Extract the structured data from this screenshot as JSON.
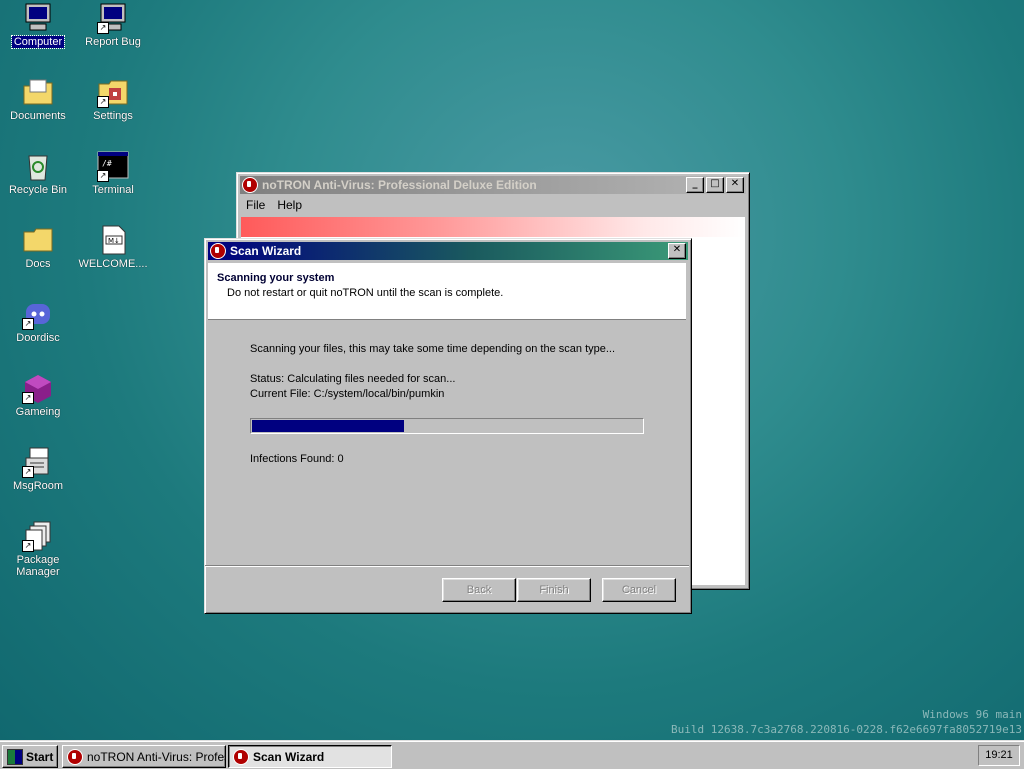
{
  "desktop": {
    "icons": [
      {
        "label": "Computer",
        "icon": "computer-icon"
      },
      {
        "label": "Report Bug",
        "icon": "report-bug-icon"
      },
      {
        "label": "Documents",
        "icon": "documents-folder-icon"
      },
      {
        "label": "Settings",
        "icon": "settings-icon"
      },
      {
        "label": "Recycle Bin",
        "icon": "recycle-bin-icon"
      },
      {
        "label": "Terminal",
        "icon": "terminal-icon"
      },
      {
        "label": "Docs",
        "icon": "folder-icon"
      },
      {
        "label": "WELCOME....",
        "icon": "markdown-file-icon"
      },
      {
        "label": "Doordisc",
        "icon": "doordisc-icon"
      },
      {
        "label": "Gameing",
        "icon": "gameing-icon"
      },
      {
        "label": "MsgRoom",
        "icon": "msgroom-icon"
      },
      {
        "label": "Package Manager",
        "icon": "package-manager-icon"
      }
    ]
  },
  "main_window": {
    "title": "noTRON Anti-Virus: Professional Deluxe Edition",
    "menu": [
      "File",
      "Help"
    ],
    "buttons": {
      "minimize": "_",
      "maximize": "□",
      "close": "✕"
    }
  },
  "wizard": {
    "title": "Scan Wizard",
    "heading": "Scanning your system",
    "subheading": "Do not restart or quit noTRON until the scan is complete.",
    "intro": "Scanning your files, this may take some time depending on the scan type...",
    "status": "Status: Calculating files needed for scan...",
    "current_file": "Current File: C:/system/local/bin/pumkin",
    "progress": 0.39,
    "infections": "Infections Found: 0",
    "buttons": {
      "back": "Back",
      "finish": "Finish",
      "cancel": "Cancel",
      "close": "✕"
    }
  },
  "watermark": {
    "line1": "Windows 96 main",
    "line2": "Build 12638.7c3a2768.220816-0228.f62e6697fa8052719e13"
  },
  "taskbar": {
    "start": "Start",
    "items": [
      "noTRON Anti-Virus: Profes...",
      "Scan Wizard"
    ],
    "clock": "19:21"
  },
  "colors": {
    "accent": "#000080",
    "progress_fill": "#000080",
    "desktop": "#2f8c8e"
  }
}
